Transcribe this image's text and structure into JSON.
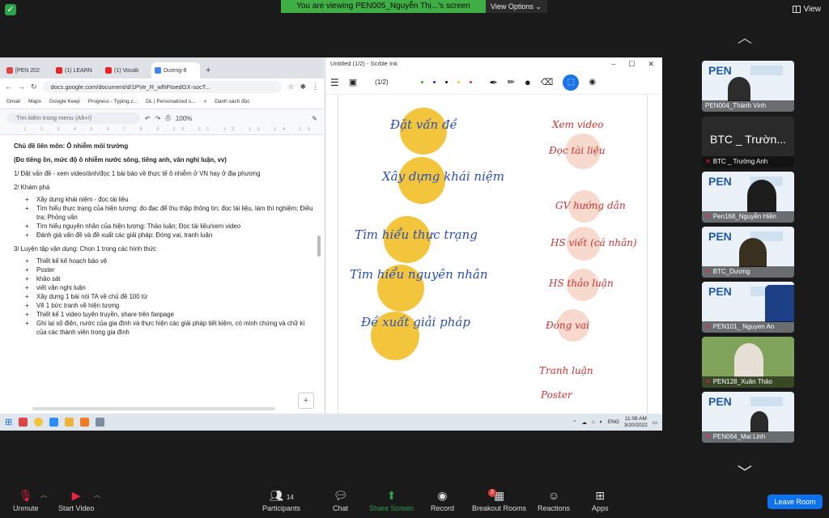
{
  "zoom": {
    "banner_text": "You are viewing PEN005_Nguyễn Thị...'s screen",
    "view_options": "View Options ⌄",
    "view_button": "View",
    "leave_button": "Leave Room",
    "controls": [
      {
        "label": "Unmute",
        "icon": "mic-muted-icon"
      },
      {
        "label": "Start Video",
        "icon": "video-off-icon"
      },
      {
        "label": "Participants",
        "icon": "participants-icon",
        "count": "14"
      },
      {
        "label": "Chat",
        "icon": "chat-icon"
      },
      {
        "label": "Share Screen",
        "icon": "share-screen-icon"
      },
      {
        "label": "Record",
        "icon": "record-icon"
      },
      {
        "label": "Breakout Rooms",
        "icon": "breakout-rooms-icon",
        "badge": "2"
      },
      {
        "label": "Reactions",
        "icon": "reactions-icon"
      },
      {
        "label": "Apps",
        "icon": "apps-icon"
      }
    ],
    "participants": [
      {
        "name": "PEN004_Thành Vinh",
        "muted": false
      },
      {
        "name": "BTC _ Trường Anh",
        "display": "BTC _ Trườn...",
        "muted": true
      },
      {
        "name": "Pen168_Nguyễn Hiền",
        "muted": true
      },
      {
        "name": "BTC_Dương",
        "muted": true
      },
      {
        "name": "PEN101_ Nguyen An",
        "muted": true
      },
      {
        "name": "PEN128_Xuân Thảo",
        "muted": true
      },
      {
        "name": "PEN064_Mai Linh",
        "muted": true
      }
    ],
    "tile_logo": "PEN",
    "colors": {
      "accent": "#0e72ed",
      "banner": "#3fae45",
      "mute": "#e24"
    }
  },
  "chrome": {
    "tabs": [
      "[PEN 202",
      "(1) LEARN",
      "(1) Vocab",
      "Dương-8"
    ],
    "new_tab": "+",
    "url": "docs.google.com/document/d/1PVe_R_wlhFtoedGX-socT...",
    "bookmarks": [
      "Gmail",
      "Maps",
      "Google Keep",
      "Progress - Typing.c...",
      "DL | Personalized s...",
      "»",
      "Danh sách đọc"
    ],
    "docs_search": "Tìm kiếm trong menu (Alt+/)",
    "zoom_level": "100%"
  },
  "document": {
    "title": "Chủ đề liên môn: Ô nhiễm môi trường",
    "subtitle": "(Đo tiếng ồn, mức độ ô nhiễm nước sông, tiếng anh, văn nghị luận, vv)",
    "step1": "1/ Đặt vấn đề - xem video/ảnh/đọc 1 bài báo về thực tế ô nhiễm ở VN hay ở địa phương",
    "step2": "2/ Khám phá",
    "step2_items": [
      "Xây dựng khái niệm - đọc tài liệu",
      "Tìm hiểu thực trạng của hiện tượng: đo đạc để thu thập thông tin; đọc tài liệu, làm thí nghiệm; Điều tra; Phỏng vấn",
      "Tìm hiểu nguyên nhân của hiện tượng: Thảo luận; Đọc tài liệu/xem video",
      "Đánh giá vấn đề và đề xuất các giải pháp: Đóng vai, tranh luận"
    ],
    "step3": "3/ Luyện tập vận dụng: Chọn 1 trong các hình thức",
    "step3_items": [
      "Thiết kế kế hoạch bảo vệ",
      "Poster",
      "khảo sát",
      "viết văn nghị luận",
      "Xây dựng 1 bài nói TA về chủ đề 100 từ",
      "Vẽ 1 bức tranh về hiện tượng",
      "Thiết kế 1 video tuyên truyền, share trên fanpage",
      "Ghi lại số điện, nước của gia đình và thực hiện các giải pháp tiết kiệm, có minh chứng và chữ kí của các thành viên trong gia đình"
    ]
  },
  "ink": {
    "window_title": "Untitled (1/2) - Scrble Ink",
    "page_indicator": "(1/2)",
    "left_notes": [
      "Đặt vấn đề",
      "Xây dựng khái niệm",
      "Tìm hiểu thực trạng",
      "Tìm hiểu nguyên nhân",
      "Đề xuất giải pháp"
    ],
    "right_notes": [
      "Xem video",
      "Đọc tài liệu",
      "GV hướng dẫn",
      "HS viết (cá nhân)",
      "HS thảo luận",
      "Đóng vai",
      "Tranh luận",
      "Poster"
    ]
  },
  "taskbar": {
    "time": "11:08 AM",
    "date": "3/20/2022",
    "lang": "ENG"
  }
}
